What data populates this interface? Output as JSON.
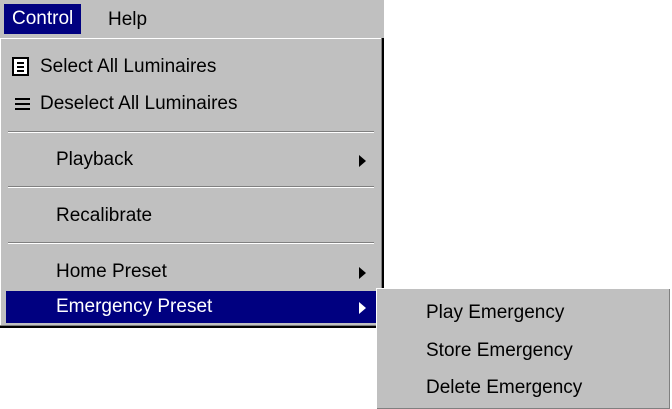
{
  "menubar": {
    "control_label": "Control",
    "help_label": "Help"
  },
  "menu": {
    "select_all": "Select All Luminaires",
    "deselect_all": "Deselect All Luminaires",
    "playback": "Playback",
    "recalibrate": "Recalibrate",
    "home_preset": "Home Preset",
    "emergency_preset": "Emergency Preset"
  },
  "submenu": {
    "play": "Play Emergency",
    "store": "Store Emergency",
    "delete": "Delete Emergency"
  },
  "icons": {
    "select_all_icon": "list-boxed-icon",
    "deselect_all_icon": "list-icon",
    "submenu_arrow": "chevron-right-icon"
  },
  "colors": {
    "menu_bg": "#c0c0c0",
    "highlight": "#000080"
  }
}
